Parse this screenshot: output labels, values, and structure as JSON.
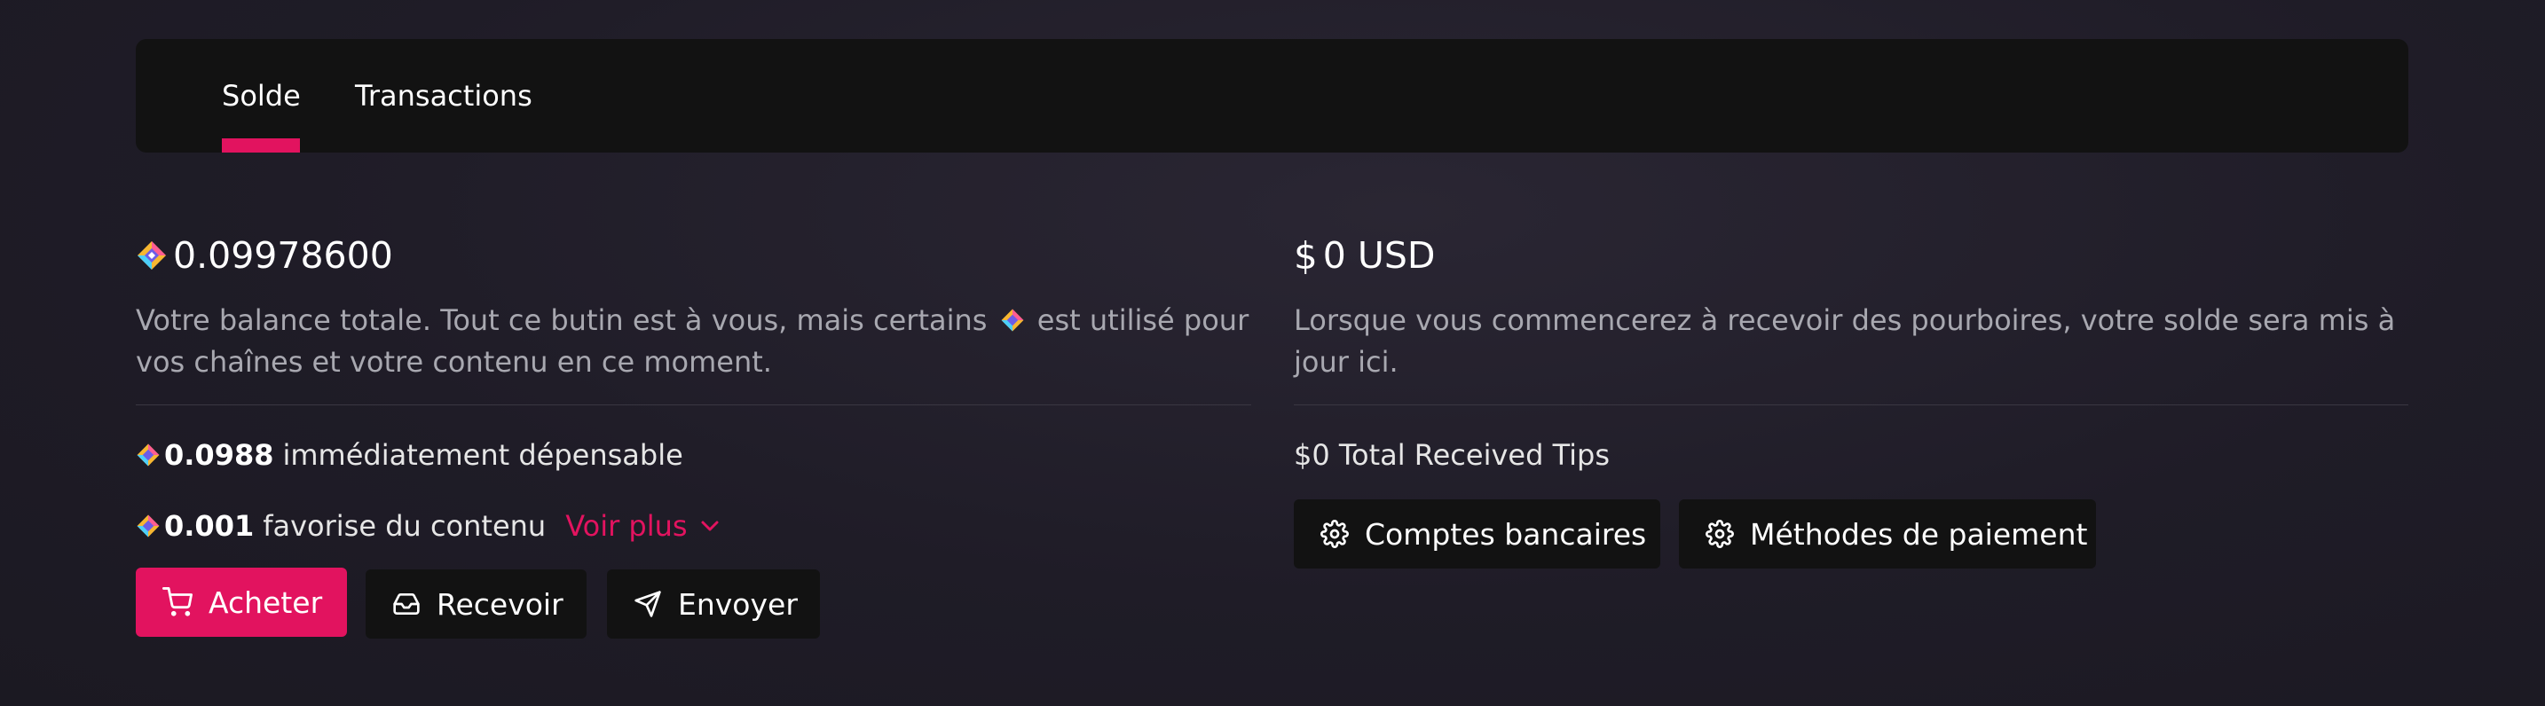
{
  "tabs": [
    {
      "label": "Solde",
      "active": true
    },
    {
      "label": "Transactions",
      "active": false
    }
  ],
  "colors": {
    "accent": "#e2135f",
    "panel": "#121212",
    "muted_text": "#a8a8b0"
  },
  "balance": {
    "icon": "lbc-credits-icon",
    "amount": "0.09978600",
    "description_part1": "Votre balance totale. Tout ce butin est à vous, mais certains",
    "description_part2": "est utilisé pour vos chaînes et votre contenu en ce moment.",
    "spendable_amount": "0.0988",
    "spendable_label": "immédiatement dépensable",
    "boost_amount": "0.001",
    "boost_label": "favorise du contenu",
    "see_more_label": "Voir plus"
  },
  "actions": {
    "buy_label": "Acheter",
    "receive_label": "Recevoir",
    "send_label": "Envoyer"
  },
  "usd": {
    "icon": "dollar-icon",
    "amount": "0 USD",
    "description": "Lorsque vous commencerez à recevoir des pourboires, votre solde sera mis à jour ici.",
    "total_tips": "$0 Total Received Tips",
    "bank_accounts_label": "Comptes bancaires",
    "payment_methods_label": "Méthodes de paiement"
  }
}
